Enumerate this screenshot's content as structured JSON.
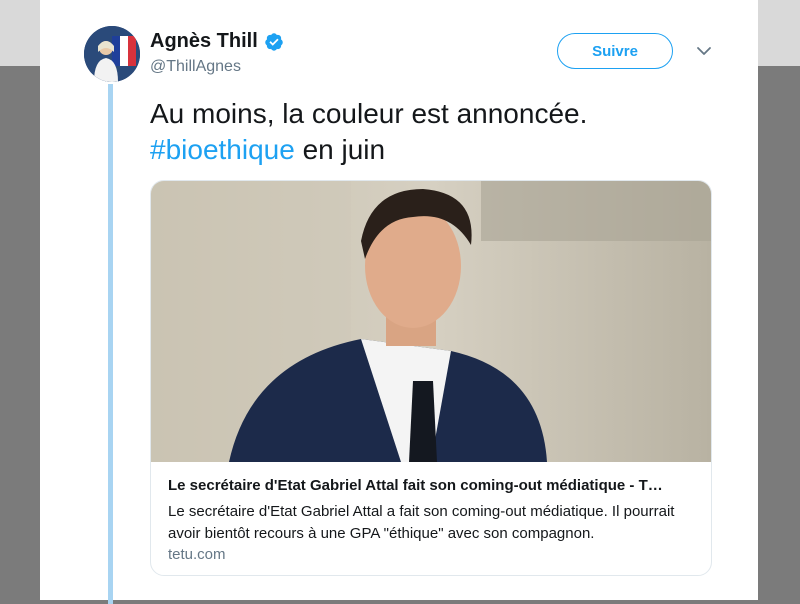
{
  "author": {
    "name": "Agnès Thill",
    "handle": "@ThillAgnes",
    "verified": true
  },
  "follow_button": {
    "label": "Suivre"
  },
  "tweet": {
    "line1": "Au moins, la couleur est annoncée.",
    "hashtag": "#bioethique",
    "line2_rest": " en juin"
  },
  "card": {
    "title": "Le secrétaire d'Etat Gabriel Attal fait son coming-out médiatique - T…",
    "description": "Le secrétaire d'Etat Gabriel Attal a fait son coming-out médiatique. Il pourrait avoir bientôt recours à une GPA \"éthique\" avec son compagnon.",
    "domain": "tetu.com"
  },
  "icons": {
    "verified": "verified-badge-icon",
    "menu": "chevron-down-icon"
  },
  "colors": {
    "accent": "#1da1f2",
    "text": "#14171a",
    "muted": "#657786",
    "thread_line": "#a8d4f2"
  }
}
